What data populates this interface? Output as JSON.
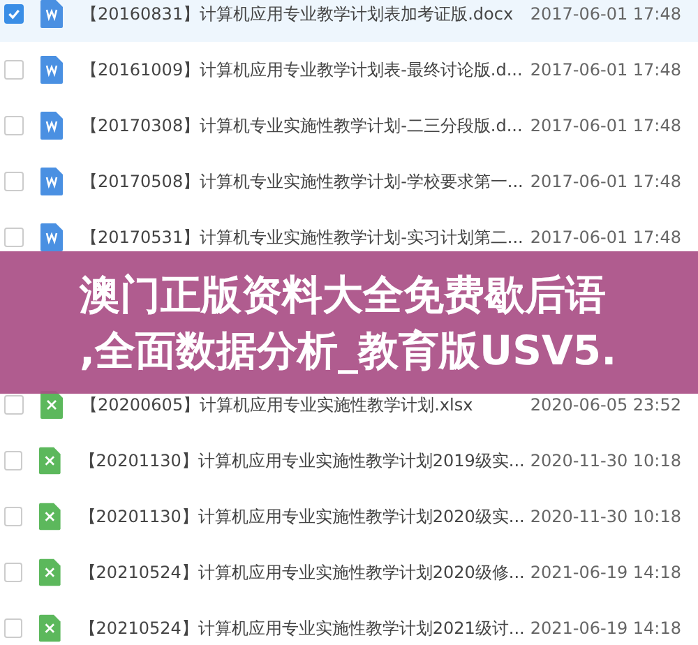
{
  "files": [
    {
      "kind": "doc",
      "selected": true,
      "name": "【20160831】计算机应用专业教学计划表加考证版.docx",
      "date": "2017-06-01 17:48"
    },
    {
      "kind": "doc",
      "selected": false,
      "name": "【20161009】计算机应用专业教学计划表-最终讨论版.d...",
      "date": "2017-06-01 17:48"
    },
    {
      "kind": "doc",
      "selected": false,
      "name": "【20170308】计算机专业实施性教学计划-二三分段版.d...",
      "date": "2017-06-01 17:48"
    },
    {
      "kind": "doc",
      "selected": false,
      "name": "【20170508】计算机专业实施性教学计划-学校要求第一...",
      "date": "2017-06-01 17:48"
    },
    {
      "kind": "doc",
      "selected": false,
      "name": "【20170531】计算机专业实施性教学计划-实习计划第二...",
      "date": "2017-06-01 17:48"
    },
    {
      "kind": "xls",
      "selected": false,
      "name": "【20200605】计算机应用专业实施性教学计划.xlsx",
      "date": "2020-06-05 23:52"
    },
    {
      "kind": "xls",
      "selected": false,
      "name": "【20201130】计算机应用专业实施性教学计划2019级实...",
      "date": "2020-11-30 10:18"
    },
    {
      "kind": "xls",
      "selected": false,
      "name": "【20201130】计算机应用专业实施性教学计划2020级实...",
      "date": "2020-11-30 10:18"
    },
    {
      "kind": "xls",
      "selected": false,
      "name": "【20210524】计算机应用专业实施性教学计划2020级修...",
      "date": "2021-06-19 14:18"
    },
    {
      "kind": "xls",
      "selected": false,
      "name": "【20210524】计算机应用专业实施性教学计划2021级讨...",
      "date": "2021-06-19 14:18"
    }
  ],
  "banner": {
    "lines": [
      "澳门正版资料大全免费歇后语",
      ",全面数据分析_教育版USV5."
    ]
  }
}
